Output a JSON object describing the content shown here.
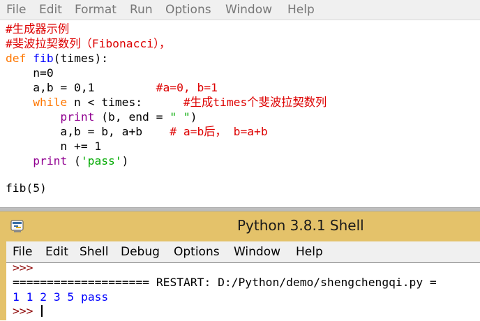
{
  "editor": {
    "menu": [
      "File",
      "Edit",
      "Format",
      "Run",
      "Options",
      "Window",
      "Help"
    ],
    "code_lines": [
      [
        {
          "t": "#生成器示例",
          "c": "comment"
        }
      ],
      [
        {
          "t": "#斐波拉契数列（Fibonacci），",
          "c": "comment"
        }
      ],
      [
        {
          "t": "def",
          "c": "keyword"
        },
        {
          "t": " ",
          "c": "default"
        },
        {
          "t": "fib",
          "c": "def"
        },
        {
          "t": "(times):",
          "c": "default"
        }
      ],
      [
        {
          "t": "    n=0",
          "c": "default"
        }
      ],
      [
        {
          "t": "    a,b = 0,1         ",
          "c": "default"
        },
        {
          "t": "#a=0, b=1",
          "c": "comment"
        }
      ],
      [
        {
          "t": "    ",
          "c": "default"
        },
        {
          "t": "while",
          "c": "keyword"
        },
        {
          "t": " n < times:      ",
          "c": "default"
        },
        {
          "t": "#生成times个斐波拉契数列",
          "c": "comment"
        }
      ],
      [
        {
          "t": "        ",
          "c": "default"
        },
        {
          "t": "print",
          "c": "builtin"
        },
        {
          "t": " (b, end = ",
          "c": "default"
        },
        {
          "t": "\" \"",
          "c": "string"
        },
        {
          "t": ")",
          "c": "default"
        }
      ],
      [
        {
          "t": "        a,b = b, a+b    ",
          "c": "default"
        },
        {
          "t": "# a=b后， b=a+b",
          "c": "comment"
        }
      ],
      [
        {
          "t": "        n += 1",
          "c": "default"
        }
      ],
      [
        {
          "t": "    ",
          "c": "default"
        },
        {
          "t": "print",
          "c": "builtin"
        },
        {
          "t": " (",
          "c": "default"
        },
        {
          "t": "'pass'",
          "c": "string"
        },
        {
          "t": ")",
          "c": "default"
        }
      ],
      [
        {
          "t": "",
          "c": "default"
        }
      ],
      [
        {
          "t": "fib(5)",
          "c": "default"
        }
      ]
    ]
  },
  "shell": {
    "title": "Python 3.8.1 Shell",
    "menu": [
      "File",
      "Edit",
      "Shell",
      "Debug",
      "Options",
      "Window",
      "Help"
    ],
    "prompt_top": ">>>",
    "restart_line": "==================== RESTART: D:/Python/demo/shengchengqi.py =",
    "output_line": "1 1 2 3 5 pass",
    "prompt_bottom": ">>> "
  },
  "colors": {
    "comment": "#dd0000",
    "keyword": "#ff7700",
    "def": "#0000ff",
    "builtin": "#900090",
    "string": "#00aa00",
    "shell_titlebar": "#e4c26a"
  },
  "icons": {
    "shell_app": "python-idle-icon"
  }
}
